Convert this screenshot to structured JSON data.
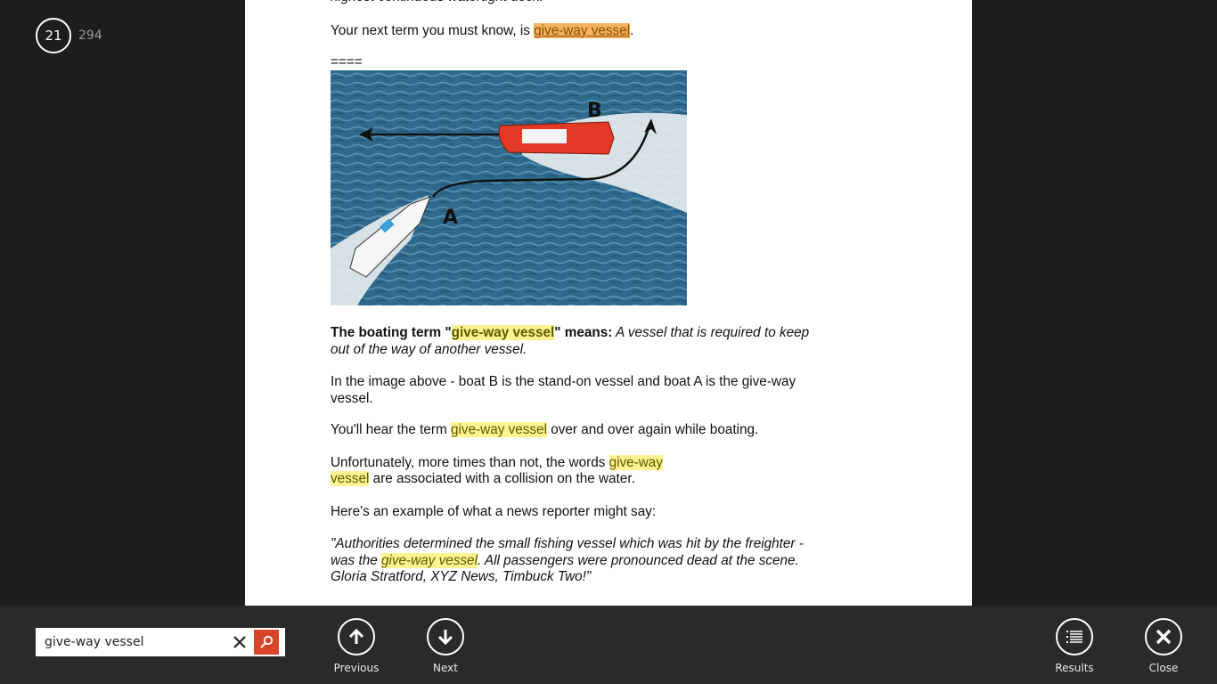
{
  "page_indicator": {
    "current": "21",
    "total": "294"
  },
  "document": {
    "line_top": "highest continuous watertight deck.",
    "p1_before": "Your next term you must know, is ",
    "p1_term": "give-way vessel",
    "p1_after": ".",
    "separator": "====",
    "figure_alt": "Boat A giving way to boat B",
    "figure_labels": {
      "a": "A",
      "b": "B"
    },
    "def_bold_1": "The boating term \"",
    "def_term": "give-way vessel",
    "def_bold_2": "\" means:",
    "def_italic": " A vessel that is required to keep out of the way of another vessel.",
    "p3": "In the image above - boat B is the stand-on vessel and boat A is the give-way vessel.",
    "p4_before": "You'll hear the term ",
    "p4_term": "give-way vessel",
    "p4_after": " over and over again while boating.",
    "p5_before": "Unfortunately, more times than not, the words ",
    "p5_term1": "give-way",
    "p5_term2": "vessel",
    "p5_after": " are associated with a collision on the water.",
    "p6": "Here's an example of what a news reporter might say:",
    "quote_before": "\"Authorities determined the small fishing vessel which was hit by the freighter - was the ",
    "quote_term": "give-way vessel",
    "quote_after": ". All passengers were pronounced dead at the scene. Gloria Stratford, XYZ News, Timbuck Two!\""
  },
  "toolbar": {
    "search_value": "give-way vessel",
    "previous_label": "Previous",
    "next_label": "Next",
    "results_label": "Results",
    "close_label": "Close"
  },
  "colors": {
    "highlight": "#fdf38f",
    "current_highlight": "#f7b25e",
    "search_button": "#d9432a"
  }
}
